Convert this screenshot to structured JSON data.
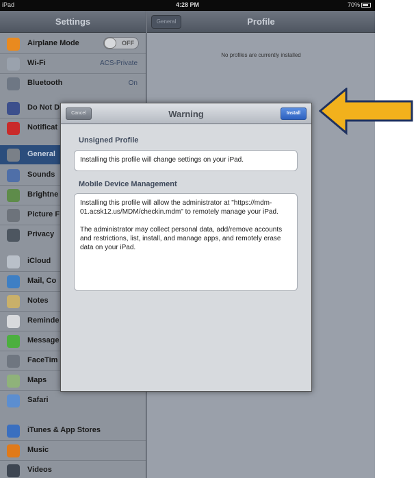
{
  "status_bar": {
    "device": "iPad",
    "time": "4:28 PM",
    "battery": "70%"
  },
  "master": {
    "title": "Settings",
    "items": [
      {
        "label": "Airplane Mode",
        "icon": "airplane-icon",
        "toggle": "OFF"
      },
      {
        "label": "Wi-Fi",
        "icon": "wifi-icon",
        "value": "ACS-Private"
      },
      {
        "label": "Bluetooth",
        "icon": "bluetooth-icon",
        "value": "On"
      },
      {
        "label": "Do Not D",
        "icon": "moon-icon"
      },
      {
        "label": "Notificat",
        "icon": "notifications-icon"
      },
      {
        "label": "General",
        "icon": "gear-icon"
      },
      {
        "label": "Sounds",
        "icon": "speaker-icon"
      },
      {
        "label": "Brightne",
        "icon": "wallpaper-icon"
      },
      {
        "label": "Picture F",
        "icon": "picture-frame-icon"
      },
      {
        "label": "Privacy",
        "icon": "hand-icon"
      },
      {
        "label": "iCloud",
        "icon": "cloud-icon"
      },
      {
        "label": "Mail, Co",
        "icon": "mail-icon"
      },
      {
        "label": "Notes",
        "icon": "notes-icon"
      },
      {
        "label": "Reminde",
        "icon": "reminders-icon"
      },
      {
        "label": "Message",
        "icon": "messages-icon"
      },
      {
        "label": "FaceTim",
        "icon": "facetime-icon"
      },
      {
        "label": "Maps",
        "icon": "maps-icon"
      },
      {
        "label": "Safari",
        "icon": "safari-icon"
      },
      {
        "label": "iTunes & App Stores",
        "icon": "app-store-icon"
      },
      {
        "label": "Music",
        "icon": "music-icon"
      },
      {
        "label": "Videos",
        "icon": "videos-icon"
      }
    ]
  },
  "detail": {
    "back_label": "General",
    "title": "Profile",
    "empty_message": "No profiles are currently installed"
  },
  "modal": {
    "title": "Warning",
    "cancel_label": "Cancel",
    "install_label": "Install",
    "section1_title": "Unsigned Profile",
    "section1_text": "Installing this profile will change settings on your iPad.",
    "section2_title": "Mobile Device Management",
    "section2_p1": "Installing this profile will allow the administrator at \"https://mdm-01.acsk12.us/MDM/checkin.mdm\" to remotely manage your iPad.",
    "section2_p2": "The administrator may collect personal data, add/remove accounts and restrictions, list, install, and manage apps, and remotely erase data on your iPad."
  },
  "colors": {
    "arrow_fill": "#f2b11c",
    "arrow_outline": "#1f3260",
    "selected_row": "#2b4d7c",
    "install_button": "#2d61c0"
  }
}
